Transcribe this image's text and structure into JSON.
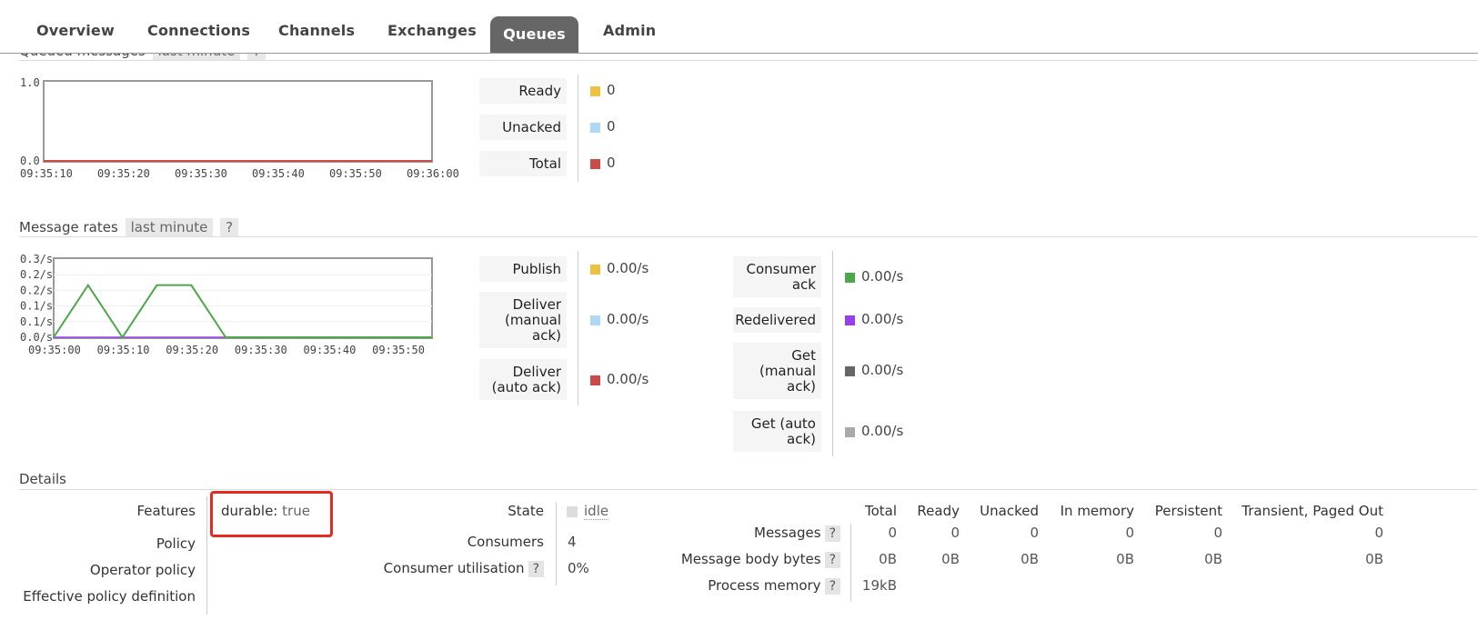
{
  "tabs": [
    {
      "label": "Overview"
    },
    {
      "label": "Connections"
    },
    {
      "label": "Channels"
    },
    {
      "label": "Exchanges"
    },
    {
      "label": "Queues",
      "active": true
    },
    {
      "label": "Admin"
    }
  ],
  "queued": {
    "title": "Queued messages",
    "period": "last minute",
    "help": "?",
    "legend": [
      {
        "label": "Ready",
        "color": "#edc240",
        "value": "0"
      },
      {
        "label": "Unacked",
        "color": "#afd8f8",
        "value": "0"
      },
      {
        "label": "Total",
        "color": "#cb4b4b",
        "value": "0"
      }
    ]
  },
  "rates": {
    "title": "Message rates",
    "period": "last minute",
    "help": "?",
    "legend_left": [
      {
        "label": "Publish",
        "color": "#edc240",
        "value": "0.00/s"
      },
      {
        "label": "Deliver (manual ack)",
        "color": "#afd8f8",
        "value": "0.00/s"
      },
      {
        "label": "Deliver (auto ack)",
        "color": "#cb4b4b",
        "value": "0.00/s"
      }
    ],
    "legend_right": [
      {
        "label": "Consumer ack",
        "color": "#4da74d",
        "value": "0.00/s"
      },
      {
        "label": "Redelivered",
        "color": "#9440ed",
        "value": "0.00/s"
      },
      {
        "label": "Get (manual ack)",
        "color": "#666666",
        "value": "0.00/s"
      },
      {
        "label": "Get (auto ack)",
        "color": "#aaaaaa",
        "value": "0.00/s"
      }
    ]
  },
  "chart_data": [
    {
      "type": "line",
      "title": "",
      "x": [
        "09:35:10",
        "09:35:20",
        "09:35:30",
        "09:35:40",
        "09:35:50",
        "09:36:00"
      ],
      "ylim": [
        0,
        1.0
      ],
      "yticks": [
        "0.0",
        "1.0"
      ],
      "series": [
        {
          "name": "Total",
          "color": "#cb4b4b",
          "values": [
            0,
            0,
            0,
            0,
            0,
            0
          ]
        }
      ]
    },
    {
      "type": "line",
      "title": "",
      "xticks": [
        "09:35:00",
        "09:35:10",
        "09:35:20",
        "09:35:30",
        "09:35:40",
        "09:35:50"
      ],
      "ylim": [
        0,
        0.3
      ],
      "yticks": [
        "0.0/s",
        "0.1/s",
        "0.1/s",
        "0.2/s",
        "0.2/s",
        "0.3/s"
      ],
      "series": [
        {
          "name": "Consumer ack",
          "color": "#4da74d",
          "x": [
            "09:35:00",
            "09:35:05",
            "09:35:10",
            "09:35:15",
            "09:35:20",
            "09:35:25",
            "09:35:55"
          ],
          "values": [
            0,
            0.2,
            0,
            0.2,
            0.2,
            0,
            0
          ]
        }
      ]
    }
  ],
  "details": {
    "title": "Details",
    "features_label": "Features",
    "features_key": "durable:",
    "features_value": "true",
    "policy_label": "Policy",
    "operator_policy_label": "Operator policy",
    "effective_policy_label": "Effective policy definition",
    "state_label": "State",
    "state_value": "idle",
    "consumers_label": "Consumers",
    "consumers_value": "4",
    "consumer_util_label": "Consumer utilisation",
    "consumer_util_value": "0%",
    "help": "?",
    "columns": [
      "Total",
      "Ready",
      "Unacked",
      "In memory",
      "Persistent",
      "Transient, Paged Out"
    ],
    "rows": [
      {
        "label": "Messages",
        "values": [
          "0",
          "0",
          "0",
          "0",
          "0",
          "0"
        ]
      },
      {
        "label": "Message body bytes",
        "values": [
          "0B",
          "0B",
          "0B",
          "0B",
          "0B",
          "0B"
        ]
      },
      {
        "label": "Process memory",
        "values": [
          "19kB"
        ]
      }
    ]
  }
}
